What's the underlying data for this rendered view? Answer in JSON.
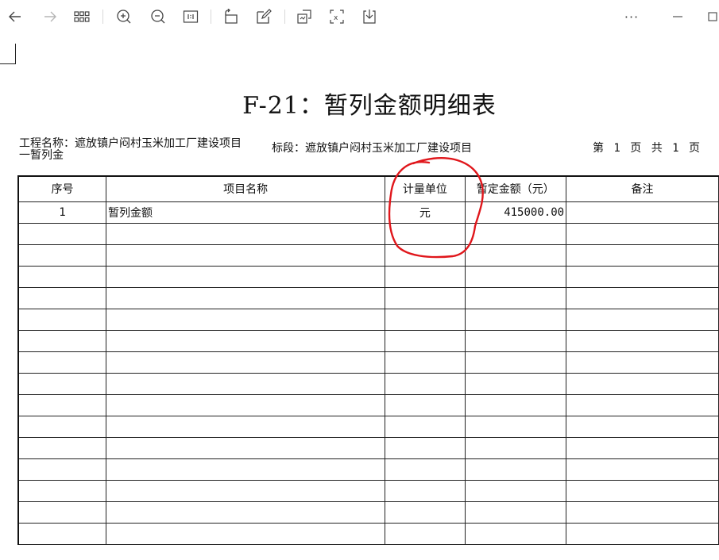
{
  "toolbar": {
    "icons": [
      "back-arrow-icon",
      "forward-arrow-icon",
      "grid-view-icon",
      "zoom-in-icon",
      "zoom-out-icon",
      "actual-size-icon",
      "rotate-icon",
      "edit-icon",
      "screenshot-icon",
      "scan-icon",
      "save-icon",
      "more-icon",
      "minimize-icon",
      "maximize-icon"
    ],
    "more_label": "···"
  },
  "document": {
    "title": "F-21：暂列金额明细表",
    "project_line1": "工程名称：遮放镇户闷村玉米加工厂建设项目",
    "project_line2": "一暂列金",
    "section": "标段：遮放镇户闷村玉米加工厂建设项目",
    "page_info": "第 1 页 共 1 页"
  },
  "table": {
    "headers": [
      "序号",
      "项目名称",
      "计量单位",
      "暂定金额（元）",
      "备注"
    ],
    "rows": [
      [
        "1",
        "暂列金额",
        "元",
        "415000.00",
        ""
      ]
    ],
    "empty_row_count": 15
  },
  "colors": {
    "annotation": "#e0161b",
    "border": "#222222"
  }
}
